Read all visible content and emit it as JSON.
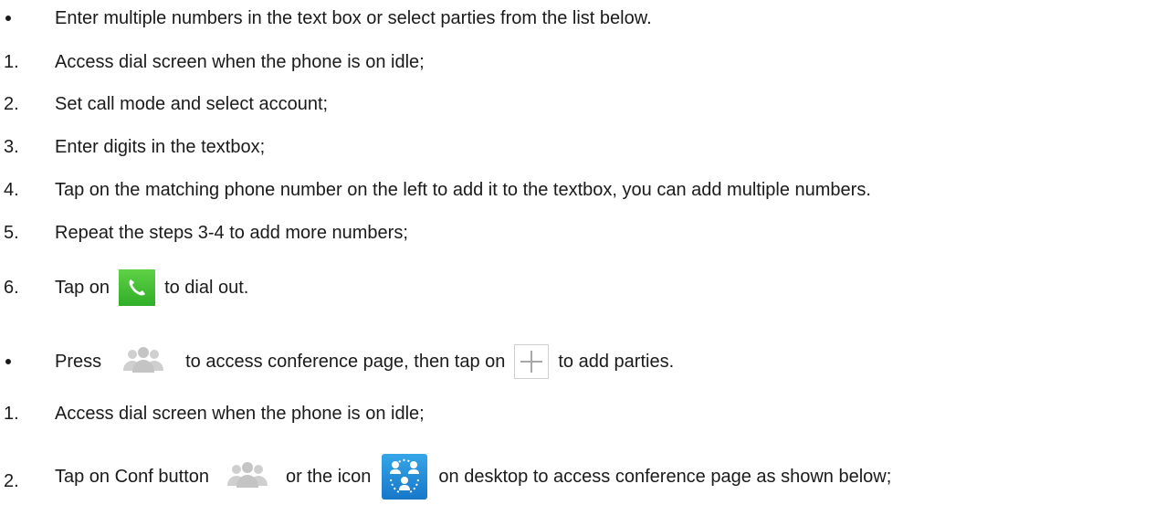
{
  "items": [
    {
      "marker": "bullet",
      "text": "Enter multiple numbers in the text box or select parties from the list below."
    },
    {
      "marker": "1.",
      "text": "Access dial screen when the phone is on idle;"
    },
    {
      "marker": "2.",
      "text": "Set call mode and select account;"
    },
    {
      "marker": "3.",
      "text": "Enter digits in the textbox;"
    },
    {
      "marker": "4.",
      "text": "Tap on the matching phone number on the left to add it to the textbox, you can add multiple numbers."
    },
    {
      "marker": "5.",
      "text": "Repeat the steps 3-4 to add more numbers;"
    },
    {
      "marker": "6.",
      "text_before": "Tap on",
      "icon": "call-icon",
      "text_after": "to dial out."
    },
    {
      "marker": "bullet",
      "text_before": "Press",
      "icon": "conference-people-icon",
      "text_middle": "to access conference page, then tap on",
      "icon2": "plus-icon",
      "text_after": "to add parties."
    },
    {
      "marker": "1.",
      "text": "Access dial screen when the phone is on idle;"
    },
    {
      "marker": "2.",
      "text_before": "Tap on Conf button",
      "icon": "conference-people-icon",
      "text_middle": "or the icon",
      "icon2": "conference-desktop-icon",
      "text_after": "on desktop to access conference page as shown below;"
    }
  ],
  "colors": {
    "call_icon": "#3cbf31",
    "conf_people_icon": "#cfcfcf",
    "conf_desktop_icon": "#1f8ad8",
    "plus_icon": "#bfbfbf"
  }
}
